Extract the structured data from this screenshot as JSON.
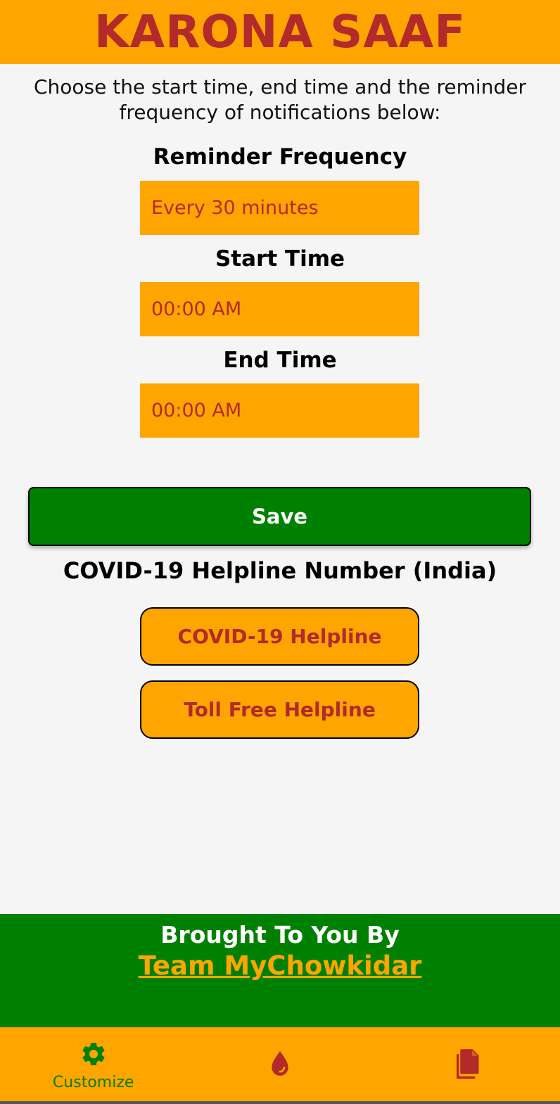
{
  "header": {
    "title": "KARONA SAAF"
  },
  "intro": {
    "text": "Choose the start time, end time and the reminder frequency of notifications below:"
  },
  "reminder": {
    "label": "Reminder Frequency",
    "value": "Every 30 minutes"
  },
  "start_time": {
    "label": "Start Time",
    "value": "00:00 AM"
  },
  "end_time": {
    "label": "End Time",
    "value": "00:00 AM"
  },
  "save": {
    "label": "Save"
  },
  "helpline": {
    "title": "COVID-19 Helpline Number (India)",
    "buttons": [
      {
        "label": "COVID-19 Helpline"
      },
      {
        "label": "Toll Free Helpline"
      }
    ]
  },
  "footer": {
    "label": "Brought To You By",
    "link": "Team MyChowkidar "
  },
  "bottom_nav": {
    "items": [
      {
        "icon": "gear-icon",
        "label": "Customize",
        "active": true
      },
      {
        "icon": "droplet-icon",
        "label": ""
      },
      {
        "icon": "documents-icon",
        "label": ""
      }
    ]
  },
  "colors": {
    "primary": "#ffa500",
    "accent_red": "#b22a2a",
    "green": "#008000"
  }
}
